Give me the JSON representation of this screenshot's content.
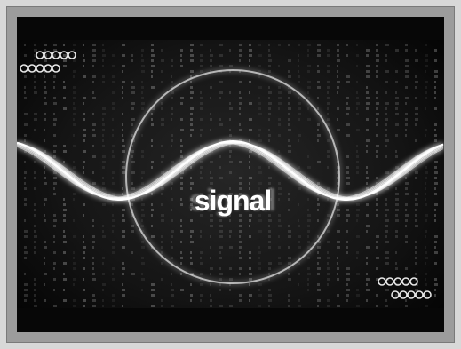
{
  "image": {
    "word": "signal",
    "colors": {
      "background": "#0b0b0b",
      "glow": "#ffffff",
      "ring": "#cfcfcf",
      "code": "#6f6f6f",
      "frame": "#d8d8d8",
      "bezel": "#9c9c9c"
    },
    "decorations": {
      "top_left_beads": "bead-chain-icon",
      "bottom_right_beads": "bead-chain-icon"
    }
  }
}
